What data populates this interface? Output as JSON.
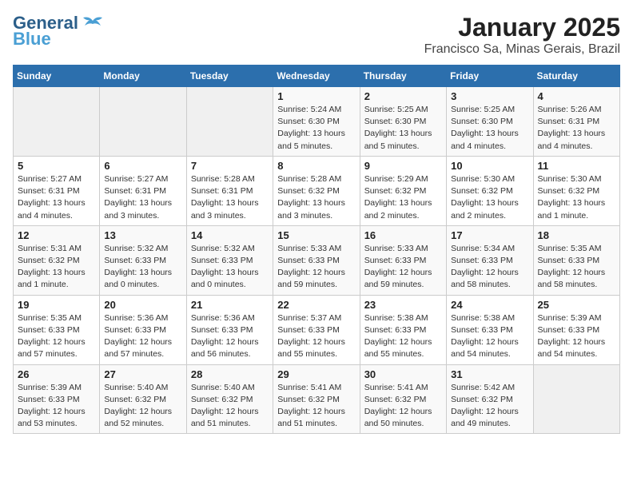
{
  "logo": {
    "line1": "General",
    "line2": "Blue"
  },
  "title": "January 2025",
  "subtitle": "Francisco Sa, Minas Gerais, Brazil",
  "days_of_week": [
    "Sunday",
    "Monday",
    "Tuesday",
    "Wednesday",
    "Thursday",
    "Friday",
    "Saturday"
  ],
  "weeks": [
    [
      {
        "day": "",
        "info": ""
      },
      {
        "day": "",
        "info": ""
      },
      {
        "day": "",
        "info": ""
      },
      {
        "day": "1",
        "info": "Sunrise: 5:24 AM\nSunset: 6:30 PM\nDaylight: 13 hours and 5 minutes."
      },
      {
        "day": "2",
        "info": "Sunrise: 5:25 AM\nSunset: 6:30 PM\nDaylight: 13 hours and 5 minutes."
      },
      {
        "day": "3",
        "info": "Sunrise: 5:25 AM\nSunset: 6:30 PM\nDaylight: 13 hours and 4 minutes."
      },
      {
        "day": "4",
        "info": "Sunrise: 5:26 AM\nSunset: 6:31 PM\nDaylight: 13 hours and 4 minutes."
      }
    ],
    [
      {
        "day": "5",
        "info": "Sunrise: 5:27 AM\nSunset: 6:31 PM\nDaylight: 13 hours and 4 minutes."
      },
      {
        "day": "6",
        "info": "Sunrise: 5:27 AM\nSunset: 6:31 PM\nDaylight: 13 hours and 3 minutes."
      },
      {
        "day": "7",
        "info": "Sunrise: 5:28 AM\nSunset: 6:31 PM\nDaylight: 13 hours and 3 minutes."
      },
      {
        "day": "8",
        "info": "Sunrise: 5:28 AM\nSunset: 6:32 PM\nDaylight: 13 hours and 3 minutes."
      },
      {
        "day": "9",
        "info": "Sunrise: 5:29 AM\nSunset: 6:32 PM\nDaylight: 13 hours and 2 minutes."
      },
      {
        "day": "10",
        "info": "Sunrise: 5:30 AM\nSunset: 6:32 PM\nDaylight: 13 hours and 2 minutes."
      },
      {
        "day": "11",
        "info": "Sunrise: 5:30 AM\nSunset: 6:32 PM\nDaylight: 13 hours and 1 minute."
      }
    ],
    [
      {
        "day": "12",
        "info": "Sunrise: 5:31 AM\nSunset: 6:32 PM\nDaylight: 13 hours and 1 minute."
      },
      {
        "day": "13",
        "info": "Sunrise: 5:32 AM\nSunset: 6:33 PM\nDaylight: 13 hours and 0 minutes."
      },
      {
        "day": "14",
        "info": "Sunrise: 5:32 AM\nSunset: 6:33 PM\nDaylight: 13 hours and 0 minutes."
      },
      {
        "day": "15",
        "info": "Sunrise: 5:33 AM\nSunset: 6:33 PM\nDaylight: 12 hours and 59 minutes."
      },
      {
        "day": "16",
        "info": "Sunrise: 5:33 AM\nSunset: 6:33 PM\nDaylight: 12 hours and 59 minutes."
      },
      {
        "day": "17",
        "info": "Sunrise: 5:34 AM\nSunset: 6:33 PM\nDaylight: 12 hours and 58 minutes."
      },
      {
        "day": "18",
        "info": "Sunrise: 5:35 AM\nSunset: 6:33 PM\nDaylight: 12 hours and 58 minutes."
      }
    ],
    [
      {
        "day": "19",
        "info": "Sunrise: 5:35 AM\nSunset: 6:33 PM\nDaylight: 12 hours and 57 minutes."
      },
      {
        "day": "20",
        "info": "Sunrise: 5:36 AM\nSunset: 6:33 PM\nDaylight: 12 hours and 57 minutes."
      },
      {
        "day": "21",
        "info": "Sunrise: 5:36 AM\nSunset: 6:33 PM\nDaylight: 12 hours and 56 minutes."
      },
      {
        "day": "22",
        "info": "Sunrise: 5:37 AM\nSunset: 6:33 PM\nDaylight: 12 hours and 55 minutes."
      },
      {
        "day": "23",
        "info": "Sunrise: 5:38 AM\nSunset: 6:33 PM\nDaylight: 12 hours and 55 minutes."
      },
      {
        "day": "24",
        "info": "Sunrise: 5:38 AM\nSunset: 6:33 PM\nDaylight: 12 hours and 54 minutes."
      },
      {
        "day": "25",
        "info": "Sunrise: 5:39 AM\nSunset: 6:33 PM\nDaylight: 12 hours and 54 minutes."
      }
    ],
    [
      {
        "day": "26",
        "info": "Sunrise: 5:39 AM\nSunset: 6:33 PM\nDaylight: 12 hours and 53 minutes."
      },
      {
        "day": "27",
        "info": "Sunrise: 5:40 AM\nSunset: 6:32 PM\nDaylight: 12 hours and 52 minutes."
      },
      {
        "day": "28",
        "info": "Sunrise: 5:40 AM\nSunset: 6:32 PM\nDaylight: 12 hours and 51 minutes."
      },
      {
        "day": "29",
        "info": "Sunrise: 5:41 AM\nSunset: 6:32 PM\nDaylight: 12 hours and 51 minutes."
      },
      {
        "day": "30",
        "info": "Sunrise: 5:41 AM\nSunset: 6:32 PM\nDaylight: 12 hours and 50 minutes."
      },
      {
        "day": "31",
        "info": "Sunrise: 5:42 AM\nSunset: 6:32 PM\nDaylight: 12 hours and 49 minutes."
      },
      {
        "day": "",
        "info": ""
      }
    ]
  ]
}
